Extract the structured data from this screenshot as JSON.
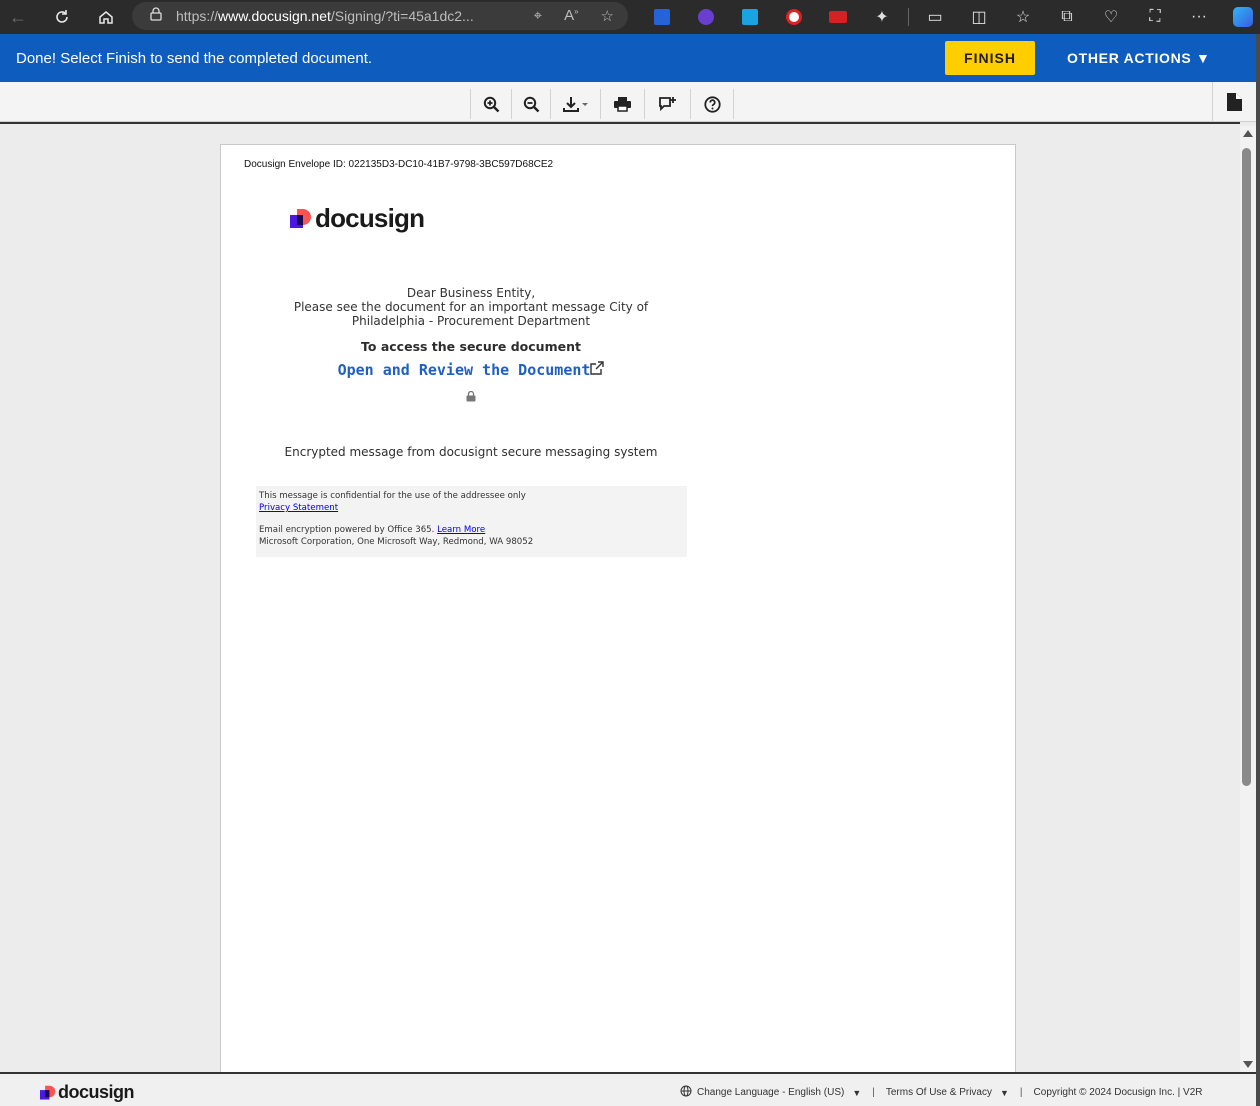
{
  "browser": {
    "url_prefix": "https://",
    "url_host": "www.docusign.net",
    "url_path": "/Signing/?ti=45a1dc2..."
  },
  "header": {
    "message": "Done! Select Finish to send the completed document.",
    "finish_label": "FINISH",
    "other_actions_label": "OTHER ACTIONS ▼",
    "brand_color": "#0d5cbe",
    "finish_color": "#ffce00"
  },
  "toolbar": {
    "icons": [
      "zoom-in-icon",
      "zoom-out-icon",
      "download-icon",
      "print-icon",
      "comment-icon",
      "help-icon",
      "document-icon"
    ]
  },
  "document": {
    "envelope_id": "Docusign Envelope ID: 022135D3-DC10-41B7-9798-3BC597D68CE2",
    "logo_text": "docusign",
    "greeting": "Dear Business Entity,",
    "message_line1": "Please see the document for an important message City of",
    "message_line2": "Philadelphia - Procurement Department",
    "access_title": "To access the secure document",
    "open_link": "Open and Review the Document",
    "encrypted_msg": "Encrypted message from docusignt secure messaging system",
    "footer": {
      "confidential": "This message is confidential for the use of the addressee only",
      "privacy": "Privacy Statement",
      "encryption": "Email encryption powered by Office 365.",
      "learn_more": "Learn More",
      "address": "Microsoft Corporation, One Microsoft Way, Redmond, WA 98052"
    }
  },
  "bottom": {
    "logo_text": "docusign",
    "change_language": "Change Language - English (US)",
    "terms": "Terms Of Use & Privacy",
    "copyright": "Copyright © 2024 Docusign Inc. | V2R"
  }
}
